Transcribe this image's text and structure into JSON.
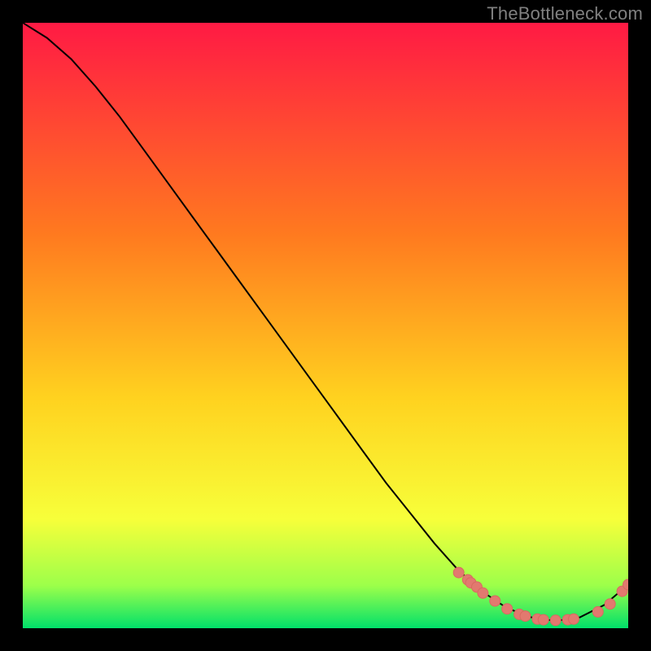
{
  "watermark": "TheBottleneck.com",
  "colors": {
    "black": "#000000",
    "curve": "#000000",
    "point_fill": "#e2796f",
    "point_stroke": "#d86a60",
    "grad_top": "#ff1a44",
    "grad_mid1": "#ff7a1f",
    "grad_mid2": "#ffd21f",
    "grad_mid3": "#f7ff3a",
    "grad_band": "#9cff4a",
    "grad_bottom": "#00e06a"
  },
  "chart_data": {
    "type": "line",
    "title": "",
    "xlabel": "",
    "ylabel": "",
    "xlim": [
      0,
      100
    ],
    "ylim": [
      0,
      100
    ],
    "curve": {
      "x": [
        0,
        4,
        8,
        12,
        16,
        20,
        24,
        28,
        32,
        36,
        40,
        44,
        48,
        52,
        56,
        60,
        64,
        68,
        72,
        76,
        80,
        84,
        88,
        92,
        96,
        100
      ],
      "y": [
        100,
        97.5,
        94,
        89.5,
        84.5,
        79,
        73.5,
        68,
        62.5,
        57,
        51.5,
        46,
        40.5,
        35,
        29.5,
        24,
        19,
        14,
        9.5,
        6,
        3.3,
        1.8,
        1.2,
        1.8,
        3.8,
        7.2
      ]
    },
    "points": {
      "x": [
        72,
        73.5,
        74,
        75,
        76,
        78,
        80,
        82,
        83,
        85,
        86,
        88,
        90,
        91,
        95,
        97,
        99,
        100
      ],
      "y": [
        9.2,
        8.0,
        7.5,
        6.8,
        5.8,
        4.5,
        3.2,
        2.3,
        2.0,
        1.5,
        1.4,
        1.3,
        1.4,
        1.5,
        2.7,
        4.0,
        6.1,
        7.2
      ]
    }
  }
}
